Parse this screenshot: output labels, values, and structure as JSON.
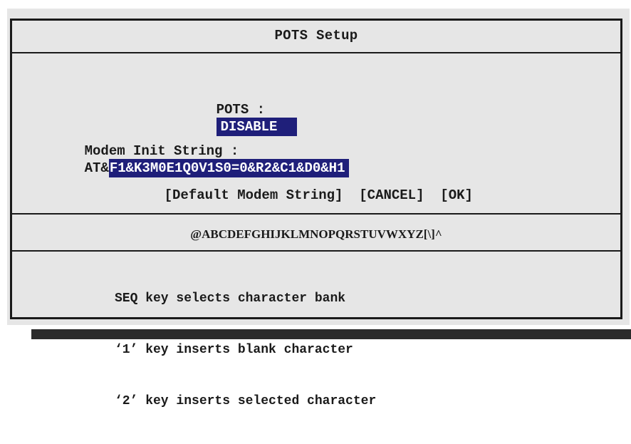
{
  "dialog": {
    "title": "POTS Setup",
    "pots_label": "POTS :",
    "pots_value": "DISABLE",
    "modem_label": "Modem Init String :",
    "modem_prefix": "AT&",
    "modem_value": "F1&K3M0E1Q0V1S0=0&R2&C1&D0&H1",
    "buttons": {
      "default_modem": "[Default Modem String]",
      "cancel": "[CANCEL]",
      "ok": "[OK]"
    },
    "character_bank": "@ABCDEFGHIJKLMNOPQRSTUVWXYZ[\\]^",
    "help": [
      "SEQ key selects character bank",
      "‘1’ key inserts blank character",
      "‘2’ key inserts selected character"
    ]
  },
  "colors": {
    "highlight": "#1f1f7a",
    "frame": "#1a1a1a",
    "background": "#e6e6e6"
  }
}
